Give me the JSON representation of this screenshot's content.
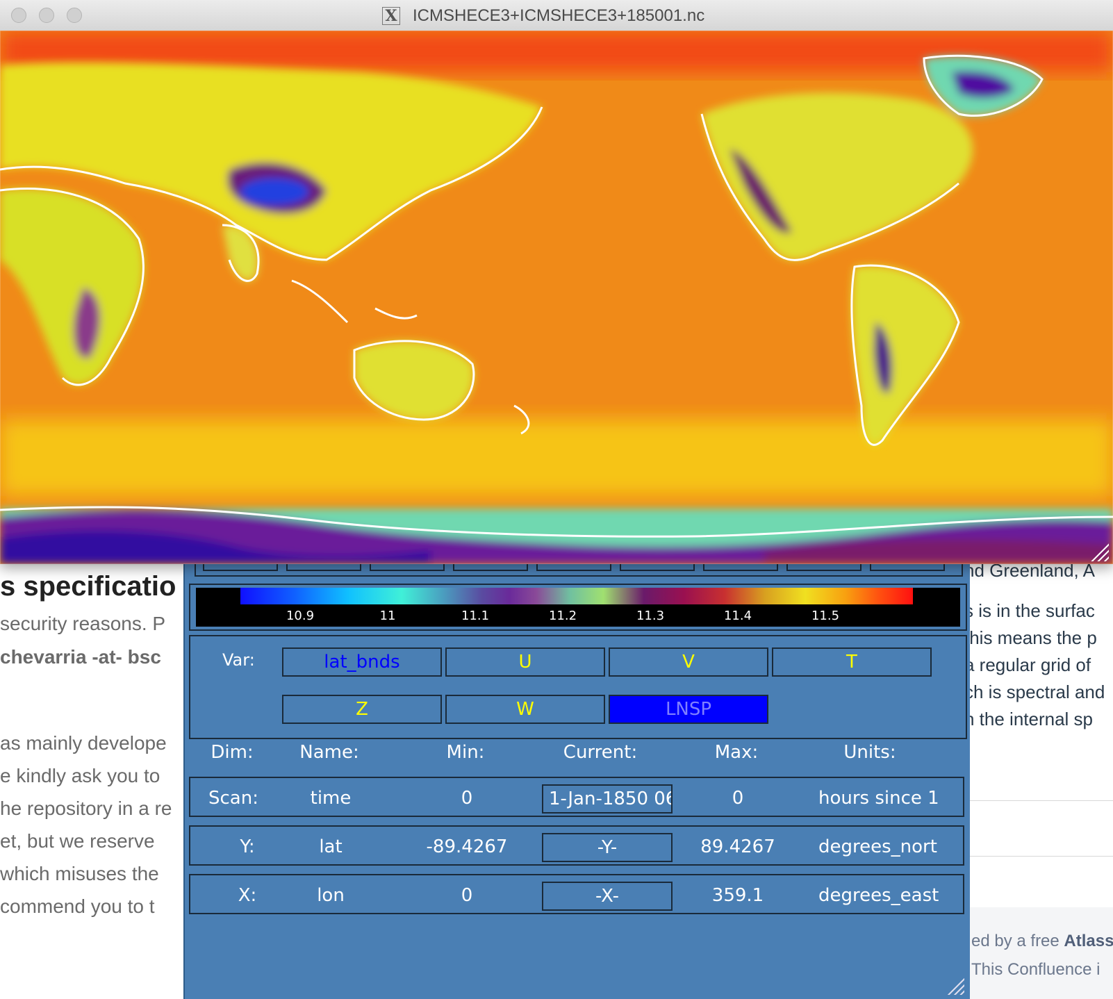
{
  "map_window": {
    "title": "ICMSHECE3+ICMSHECE3+185001.nc"
  },
  "colorbar": {
    "ticks": [
      "10.9",
      "11",
      "11.1",
      "11.2",
      "11.3",
      "11.4",
      "11.5"
    ]
  },
  "variables": {
    "label": "Var:",
    "buttons": [
      "lat_bnds",
      "U",
      "V",
      "T",
      "Z",
      "W",
      "LNSP"
    ],
    "selected": "LNSP"
  },
  "dims_header": {
    "dim": "Dim:",
    "name": "Name:",
    "min": "Min:",
    "current": "Current:",
    "max": "Max:",
    "units": "Units:"
  },
  "dims": [
    {
      "dim": "Scan:",
      "name": "time",
      "min": "0",
      "current": "1-Jan-1850 06",
      "max": "0",
      "units": "hours since 1"
    },
    {
      "dim": "Y:",
      "name": "lat",
      "min": "-89.4267",
      "current": "-Y-",
      "max": "89.4267",
      "units": "degrees_nort"
    },
    {
      "dim": "X:",
      "name": "lon",
      "min": "0",
      "current": "-X-",
      "max": "359.1",
      "units": "degrees_east"
    }
  ],
  "background_page": {
    "heading": "s specificatio",
    "left_lines": [
      "security reasons. P",
      "chevarria -at- bsc",
      "as mainly develope",
      "e kindly ask you to",
      "he repository in a re",
      "et, but we reserve",
      "which misuses the",
      "commend you to t"
    ],
    "right_lines": [
      "nd Greenland, A",
      "s is in the surfac",
      "this means the p",
      "a regular grid of",
      "ch is spectral and",
      "n the internal sp"
    ],
    "footer_line1_prefix": "ed by a free ",
    "footer_line1_bold": "Atlass",
    "footer_line2": "This Confluence i"
  },
  "colors": {
    "panel": "#4a7fb4",
    "selected_button": "#0000ff",
    "button_text": "#ffff00"
  }
}
